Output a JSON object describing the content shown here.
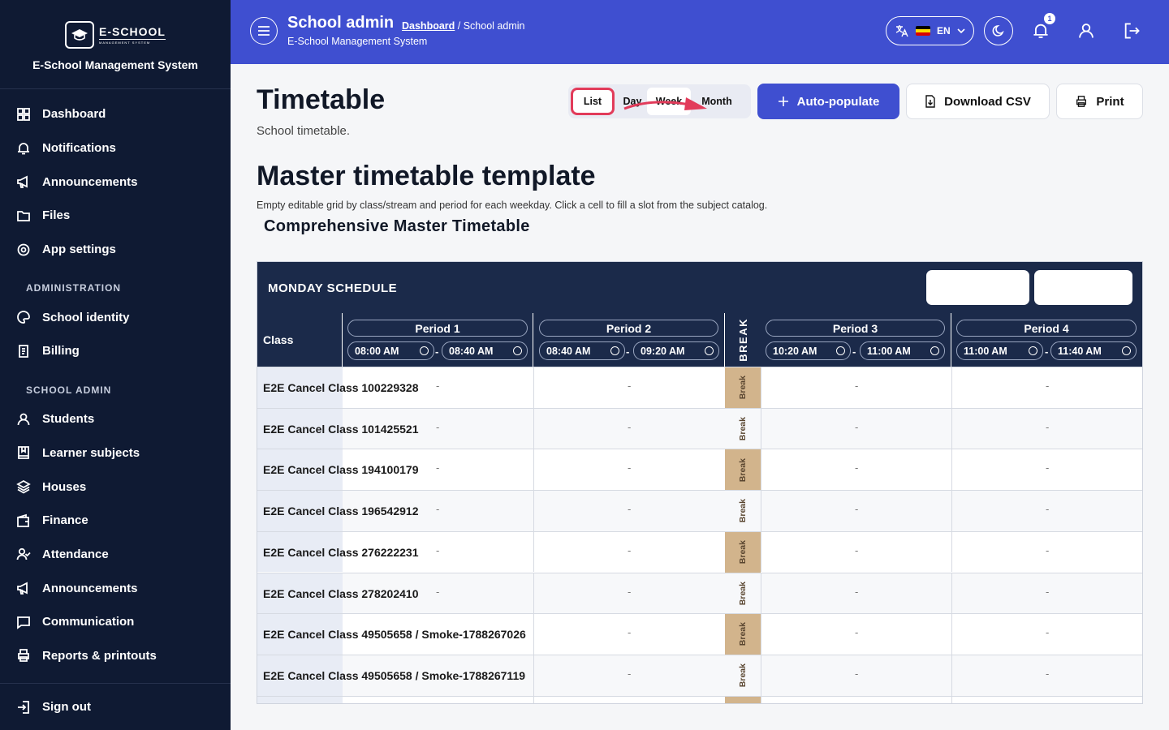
{
  "sidebar": {
    "logo_big": "E-SCHOOL",
    "logo_small": "MANAGEMENT SYSTEM",
    "system_name": "E-School Management System",
    "items_top": [
      {
        "label": "Dashboard",
        "icon": "grid-icon"
      },
      {
        "label": "Notifications",
        "icon": "bell-icon"
      },
      {
        "label": "Announcements",
        "icon": "megaphone-icon"
      },
      {
        "label": "Files",
        "icon": "folder-icon"
      },
      {
        "label": "App settings",
        "icon": "gear-icon"
      }
    ],
    "section_admin": "ADMINISTRATION",
    "items_admin": [
      {
        "label": "School identity",
        "icon": "palette-icon"
      },
      {
        "label": "Billing",
        "icon": "receipt-icon"
      }
    ],
    "section_school": "SCHOOL ADMIN",
    "items_school": [
      {
        "label": "Students",
        "icon": "user-icon"
      },
      {
        "label": "Learner subjects",
        "icon": "book-icon"
      },
      {
        "label": "Houses",
        "icon": "layers-icon"
      },
      {
        "label": "Finance",
        "icon": "wallet-icon"
      },
      {
        "label": "Attendance",
        "icon": "user-check-icon"
      },
      {
        "label": "Announcements",
        "icon": "megaphone-icon"
      },
      {
        "label": "Communication",
        "icon": "message-icon"
      },
      {
        "label": "Reports & printouts",
        "icon": "printer-icon"
      }
    ],
    "sign_out": "Sign out"
  },
  "topbar": {
    "title": "School admin",
    "crumb_link": "Dashboard",
    "crumb_rest": " / School admin",
    "subtitle": "E-School Management System",
    "lang": "EN",
    "notif_count": "1"
  },
  "main": {
    "title": "Timetable",
    "subtitle": "School timetable.",
    "views": [
      "List",
      "Day",
      "Week",
      "Month"
    ],
    "auto_populate": "Auto-populate",
    "download_csv": "Download CSV",
    "print": "Print",
    "section_title": "Master timetable template",
    "section_desc": "Empty editable grid by class/stream and period for each weekday. Click a cell to fill a slot from the subject catalog.",
    "sub_title": "Comprehensive Master Timetable"
  },
  "timetable": {
    "day_label": "MONDAY SCHEDULE",
    "class_header": "Class",
    "break_header": "BREAK",
    "break_cell": "Break",
    "empty": "-",
    "periods": [
      {
        "name": "Period 1",
        "start": "08:00 AM",
        "end": "08:40 AM"
      },
      {
        "name": "Period 2",
        "start": "08:40 AM",
        "end": "09:20 AM"
      },
      {
        "name": "Period 3",
        "start": "10:20 AM",
        "end": "11:00 AM"
      },
      {
        "name": "Period 4",
        "start": "11:00 AM",
        "end": "11:40 AM"
      }
    ],
    "rows": [
      "E2E Cancel Class 100229328",
      "E2E Cancel Class 101425521",
      "E2E Cancel Class 194100179",
      "E2E Cancel Class 196542912",
      "E2E Cancel Class 276222231",
      "E2E Cancel Class 278202410",
      "E2E Cancel Class 49505658 / Smoke-1788267026",
      "E2E Cancel Class 49505658 / Smoke-1788267119"
    ]
  },
  "colors": {
    "sidebar_bg": "#0f1a33",
    "topbar_bg": "#3f4fd0",
    "table_header_bg": "#1b2a4a",
    "break_bg": "#d2b48c",
    "highlight": "#e23b5a"
  }
}
